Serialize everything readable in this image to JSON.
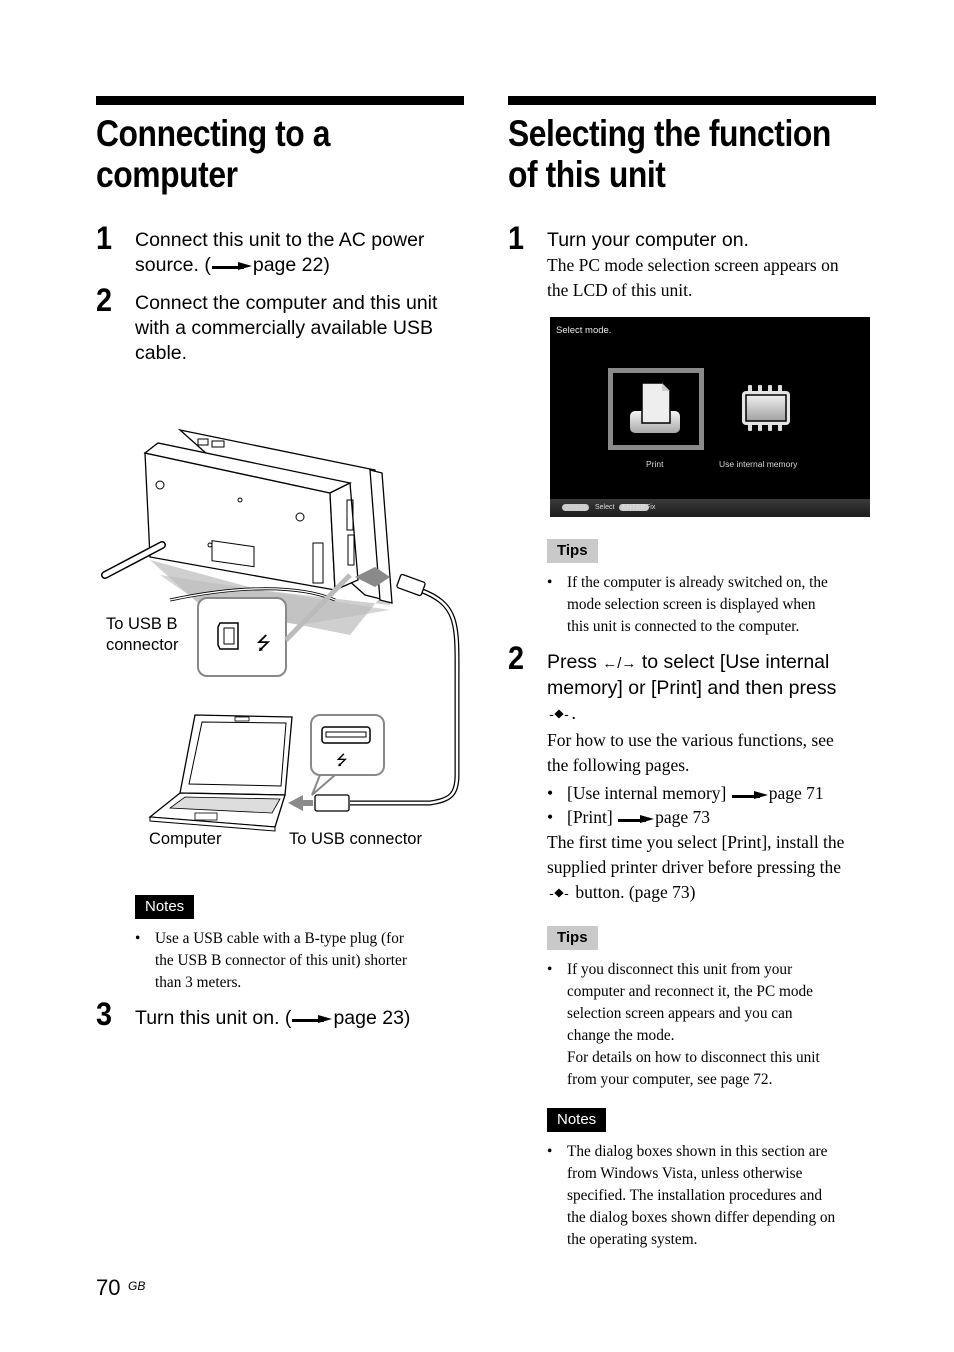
{
  "left": {
    "title_line1": "Connecting to a",
    "title_line2": "computer",
    "steps": [
      {
        "num": "1",
        "line1": "Connect this unit to the AC power",
        "line2_pre": "source. (",
        "line2_post": "page 22)"
      },
      {
        "num": "2",
        "line1": "Connect the computer and this unit",
        "line2": "with a commercially available USB",
        "line3": "cable."
      },
      {
        "num": "3",
        "text_pre": "Turn this unit on. (",
        "text_post": "page 23)"
      }
    ],
    "figure": {
      "label_usb_b_line1": "To USB B",
      "label_usb_b_line2": "connector",
      "label_computer": "Computer",
      "label_usb": "To USB connector"
    },
    "notes": {
      "badge": "Notes",
      "items": [
        {
          "l1": "Use a USB cable with a B-type plug (for",
          "l2": "the USB B connector of this unit) shorter",
          "l3": "than 3 meters."
        }
      ]
    }
  },
  "right": {
    "title_line1": "Selecting the function",
    "title_line2": "of this unit",
    "step1": {
      "num": "1",
      "heading": "Turn your computer on.",
      "body_l1": "The PC mode selection screen appears on",
      "body_l2": "the LCD of this unit."
    },
    "lcd": {
      "title": "Select mode.",
      "options": [
        {
          "label": "Print",
          "icon": "print-icon",
          "selected": true
        },
        {
          "label": "Use internal memory",
          "icon": "memory-chip-icon",
          "selected": false
        }
      ],
      "footer_keys": "←→↑↓",
      "footer_select": "Select",
      "footer_enter": "ENTER",
      "footer_fix": "Fix"
    },
    "tips1": {
      "badge": "Tips",
      "l1": "If the computer is already switched on, the",
      "l2": "mode selection screen is displayed when",
      "l3": "this unit is connected to the computer."
    },
    "step2": {
      "num": "2",
      "h_l1_pre": "Press ",
      "h_arrows": "←/→",
      "h_l1_post": " to select [Use internal",
      "h_l2": "memory] or [Print] and then press",
      "h_l3": ".",
      "body_l1": "For how to use the various functions, see",
      "body_l2": "the following pages.",
      "links": [
        {
          "label": "[Use internal memory]",
          "page": "page 71"
        },
        {
          "label": "[Print]",
          "page": "page 73"
        }
      ],
      "after_l1": "The first time you select [Print], install the",
      "after_l2": "supplied printer driver before pressing the",
      "after_l3": " button. (page 73)"
    },
    "tips2": {
      "badge": "Tips",
      "l1": "If you disconnect this unit from your",
      "l2": "computer and reconnect it, the PC mode",
      "l3": "selection screen appears and you can",
      "l4": "change the mode.",
      "l5": "For details on how to disconnect this unit",
      "l6": "from your computer, see page 72."
    },
    "notes": {
      "badge": "Notes",
      "l1": "The dialog boxes shown in this section are",
      "l2": "from Windows Vista, unless otherwise",
      "l3": "specified. The installation procedures and",
      "l4": "the dialog boxes shown differ depending on",
      "l5": "the operating system."
    }
  },
  "footer": {
    "page_number": "70",
    "region": "GB"
  }
}
